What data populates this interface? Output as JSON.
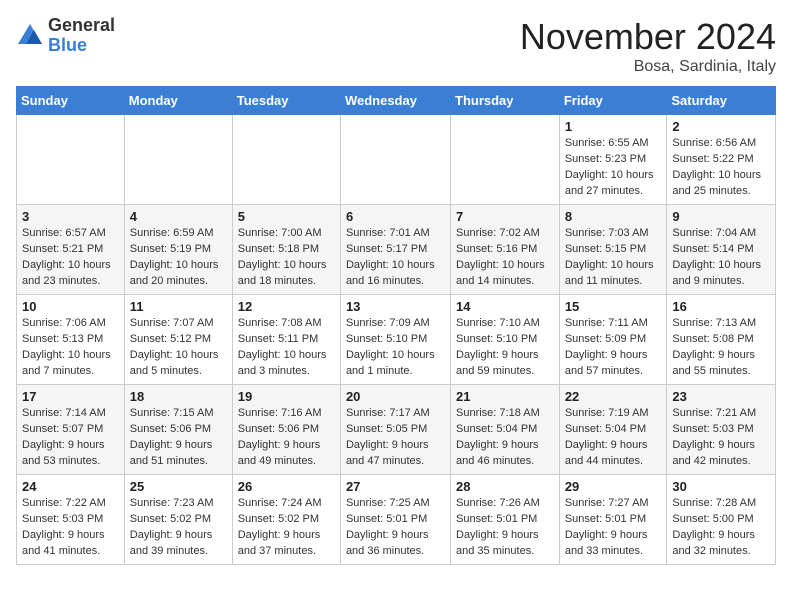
{
  "header": {
    "logo": {
      "general": "General",
      "blue": "Blue"
    },
    "month": "November 2024",
    "location": "Bosa, Sardinia, Italy"
  },
  "days_of_week": [
    "Sunday",
    "Monday",
    "Tuesday",
    "Wednesday",
    "Thursday",
    "Friday",
    "Saturday"
  ],
  "weeks": [
    [
      {
        "day": "",
        "info": ""
      },
      {
        "day": "",
        "info": ""
      },
      {
        "day": "",
        "info": ""
      },
      {
        "day": "",
        "info": ""
      },
      {
        "day": "",
        "info": ""
      },
      {
        "day": "1",
        "info": "Sunrise: 6:55 AM\nSunset: 5:23 PM\nDaylight: 10 hours\nand 27 minutes."
      },
      {
        "day": "2",
        "info": "Sunrise: 6:56 AM\nSunset: 5:22 PM\nDaylight: 10 hours\nand 25 minutes."
      }
    ],
    [
      {
        "day": "3",
        "info": "Sunrise: 6:57 AM\nSunset: 5:21 PM\nDaylight: 10 hours\nand 23 minutes."
      },
      {
        "day": "4",
        "info": "Sunrise: 6:59 AM\nSunset: 5:19 PM\nDaylight: 10 hours\nand 20 minutes."
      },
      {
        "day": "5",
        "info": "Sunrise: 7:00 AM\nSunset: 5:18 PM\nDaylight: 10 hours\nand 18 minutes."
      },
      {
        "day": "6",
        "info": "Sunrise: 7:01 AM\nSunset: 5:17 PM\nDaylight: 10 hours\nand 16 minutes."
      },
      {
        "day": "7",
        "info": "Sunrise: 7:02 AM\nSunset: 5:16 PM\nDaylight: 10 hours\nand 14 minutes."
      },
      {
        "day": "8",
        "info": "Sunrise: 7:03 AM\nSunset: 5:15 PM\nDaylight: 10 hours\nand 11 minutes."
      },
      {
        "day": "9",
        "info": "Sunrise: 7:04 AM\nSunset: 5:14 PM\nDaylight: 10 hours\nand 9 minutes."
      }
    ],
    [
      {
        "day": "10",
        "info": "Sunrise: 7:06 AM\nSunset: 5:13 PM\nDaylight: 10 hours\nand 7 minutes."
      },
      {
        "day": "11",
        "info": "Sunrise: 7:07 AM\nSunset: 5:12 PM\nDaylight: 10 hours\nand 5 minutes."
      },
      {
        "day": "12",
        "info": "Sunrise: 7:08 AM\nSunset: 5:11 PM\nDaylight: 10 hours\nand 3 minutes."
      },
      {
        "day": "13",
        "info": "Sunrise: 7:09 AM\nSunset: 5:10 PM\nDaylight: 10 hours\nand 1 minute."
      },
      {
        "day": "14",
        "info": "Sunrise: 7:10 AM\nSunset: 5:10 PM\nDaylight: 9 hours\nand 59 minutes."
      },
      {
        "day": "15",
        "info": "Sunrise: 7:11 AM\nSunset: 5:09 PM\nDaylight: 9 hours\nand 57 minutes."
      },
      {
        "day": "16",
        "info": "Sunrise: 7:13 AM\nSunset: 5:08 PM\nDaylight: 9 hours\nand 55 minutes."
      }
    ],
    [
      {
        "day": "17",
        "info": "Sunrise: 7:14 AM\nSunset: 5:07 PM\nDaylight: 9 hours\nand 53 minutes."
      },
      {
        "day": "18",
        "info": "Sunrise: 7:15 AM\nSunset: 5:06 PM\nDaylight: 9 hours\nand 51 minutes."
      },
      {
        "day": "19",
        "info": "Sunrise: 7:16 AM\nSunset: 5:06 PM\nDaylight: 9 hours\nand 49 minutes."
      },
      {
        "day": "20",
        "info": "Sunrise: 7:17 AM\nSunset: 5:05 PM\nDaylight: 9 hours\nand 47 minutes."
      },
      {
        "day": "21",
        "info": "Sunrise: 7:18 AM\nSunset: 5:04 PM\nDaylight: 9 hours\nand 46 minutes."
      },
      {
        "day": "22",
        "info": "Sunrise: 7:19 AM\nSunset: 5:04 PM\nDaylight: 9 hours\nand 44 minutes."
      },
      {
        "day": "23",
        "info": "Sunrise: 7:21 AM\nSunset: 5:03 PM\nDaylight: 9 hours\nand 42 minutes."
      }
    ],
    [
      {
        "day": "24",
        "info": "Sunrise: 7:22 AM\nSunset: 5:03 PM\nDaylight: 9 hours\nand 41 minutes."
      },
      {
        "day": "25",
        "info": "Sunrise: 7:23 AM\nSunset: 5:02 PM\nDaylight: 9 hours\nand 39 minutes."
      },
      {
        "day": "26",
        "info": "Sunrise: 7:24 AM\nSunset: 5:02 PM\nDaylight: 9 hours\nand 37 minutes."
      },
      {
        "day": "27",
        "info": "Sunrise: 7:25 AM\nSunset: 5:01 PM\nDaylight: 9 hours\nand 36 minutes."
      },
      {
        "day": "28",
        "info": "Sunrise: 7:26 AM\nSunset: 5:01 PM\nDaylight: 9 hours\nand 35 minutes."
      },
      {
        "day": "29",
        "info": "Sunrise: 7:27 AM\nSunset: 5:01 PM\nDaylight: 9 hours\nand 33 minutes."
      },
      {
        "day": "30",
        "info": "Sunrise: 7:28 AM\nSunset: 5:00 PM\nDaylight: 9 hours\nand 32 minutes."
      }
    ]
  ]
}
